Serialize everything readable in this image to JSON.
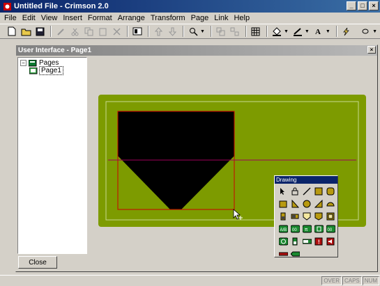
{
  "app": {
    "title": "Untitled File - Crimson 2.0"
  },
  "menu": [
    "File",
    "Edit",
    "View",
    "Insert",
    "Format",
    "Arrange",
    "Transform",
    "Page",
    "Link",
    "Help"
  ],
  "child_window": {
    "title": "User Interface - Page1"
  },
  "tree": {
    "root": "Pages",
    "child": "Page1"
  },
  "buttons": {
    "close": "Close"
  },
  "palette": {
    "title": "Drawing"
  },
  "status": [
    "OVER",
    "CAPS",
    "NUM"
  ],
  "colors": {
    "canvas_green": "#7d9b00",
    "shape_black": "#000000",
    "selection_red": "#cc0000"
  }
}
